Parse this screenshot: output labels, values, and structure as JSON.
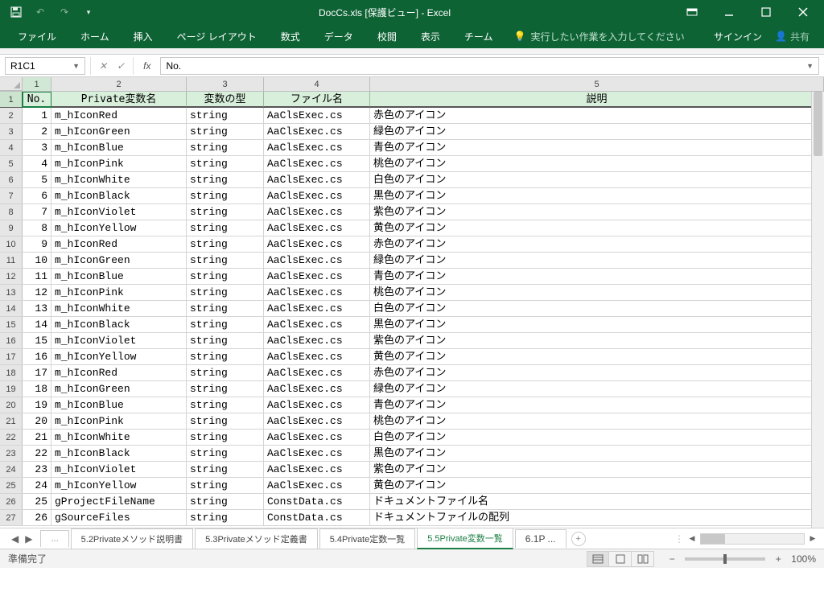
{
  "title": "DocCs.xls [保護ビュー] - Excel",
  "ribbon": {
    "file": "ファイル",
    "home": "ホーム",
    "insert": "挿入",
    "pagelayout": "ページ レイアウト",
    "formulas": "数式",
    "data": "データ",
    "review": "校閲",
    "view": "表示",
    "team": "チーム",
    "tellme": "実行したい作業を入力してください",
    "signin": "サインイン",
    "share": "共有"
  },
  "namebox": "R1C1",
  "formula": "No.",
  "colnums": {
    "c1": "1",
    "c2": "2",
    "c3": "3",
    "c4": "4",
    "c5": "5"
  },
  "headers": {
    "no": "No.",
    "name": "Private変数名",
    "type": "変数の型",
    "file": "ファイル名",
    "desc": "説明"
  },
  "rows": [
    {
      "n": "1",
      "name": "m_hIconRed",
      "type": "string",
      "file": "AaClsExec.cs",
      "desc": "赤色のアイコン"
    },
    {
      "n": "2",
      "name": "m_hIconGreen",
      "type": "string",
      "file": "AaClsExec.cs",
      "desc": "緑色のアイコン"
    },
    {
      "n": "3",
      "name": "m_hIconBlue",
      "type": "string",
      "file": "AaClsExec.cs",
      "desc": "青色のアイコン"
    },
    {
      "n": "4",
      "name": "m_hIconPink",
      "type": "string",
      "file": "AaClsExec.cs",
      "desc": "桃色のアイコン"
    },
    {
      "n": "5",
      "name": "m_hIconWhite",
      "type": "string",
      "file": "AaClsExec.cs",
      "desc": "白色のアイコン"
    },
    {
      "n": "6",
      "name": "m_hIconBlack",
      "type": "string",
      "file": "AaClsExec.cs",
      "desc": "黒色のアイコン"
    },
    {
      "n": "7",
      "name": "m_hIconViolet",
      "type": "string",
      "file": "AaClsExec.cs",
      "desc": "紫色のアイコン"
    },
    {
      "n": "8",
      "name": "m_hIconYellow",
      "type": "string",
      "file": "AaClsExec.cs",
      "desc": "黄色のアイコン"
    },
    {
      "n": "9",
      "name": "m_hIconRed",
      "type": "string",
      "file": "AaClsExec.cs",
      "desc": "赤色のアイコン"
    },
    {
      "n": "10",
      "name": "m_hIconGreen",
      "type": "string",
      "file": "AaClsExec.cs",
      "desc": "緑色のアイコン"
    },
    {
      "n": "11",
      "name": "m_hIconBlue",
      "type": "string",
      "file": "AaClsExec.cs",
      "desc": "青色のアイコン"
    },
    {
      "n": "12",
      "name": "m_hIconPink",
      "type": "string",
      "file": "AaClsExec.cs",
      "desc": "桃色のアイコン"
    },
    {
      "n": "13",
      "name": "m_hIconWhite",
      "type": "string",
      "file": "AaClsExec.cs",
      "desc": "白色のアイコン"
    },
    {
      "n": "14",
      "name": "m_hIconBlack",
      "type": "string",
      "file": "AaClsExec.cs",
      "desc": "黒色のアイコン"
    },
    {
      "n": "15",
      "name": "m_hIconViolet",
      "type": "string",
      "file": "AaClsExec.cs",
      "desc": "紫色のアイコン"
    },
    {
      "n": "16",
      "name": "m_hIconYellow",
      "type": "string",
      "file": "AaClsExec.cs",
      "desc": "黄色のアイコン"
    },
    {
      "n": "17",
      "name": "m_hIconRed",
      "type": "string",
      "file": "AaClsExec.cs",
      "desc": "赤色のアイコン"
    },
    {
      "n": "18",
      "name": "m_hIconGreen",
      "type": "string",
      "file": "AaClsExec.cs",
      "desc": "緑色のアイコン"
    },
    {
      "n": "19",
      "name": "m_hIconBlue",
      "type": "string",
      "file": "AaClsExec.cs",
      "desc": "青色のアイコン"
    },
    {
      "n": "20",
      "name": "m_hIconPink",
      "type": "string",
      "file": "AaClsExec.cs",
      "desc": "桃色のアイコン"
    },
    {
      "n": "21",
      "name": "m_hIconWhite",
      "type": "string",
      "file": "AaClsExec.cs",
      "desc": "白色のアイコン"
    },
    {
      "n": "22",
      "name": "m_hIconBlack",
      "type": "string",
      "file": "AaClsExec.cs",
      "desc": "黒色のアイコン"
    },
    {
      "n": "23",
      "name": "m_hIconViolet",
      "type": "string",
      "file": "AaClsExec.cs",
      "desc": "紫色のアイコン"
    },
    {
      "n": "24",
      "name": "m_hIconYellow",
      "type": "string",
      "file": "AaClsExec.cs",
      "desc": "黄色のアイコン"
    },
    {
      "n": "25",
      "name": "gProjectFileName",
      "type": "string",
      "file": "ConstData.cs",
      "desc": "ドキュメントファイル名"
    },
    {
      "n": "26",
      "name": "gSourceFiles",
      "type": "string",
      "file": "ConstData.cs",
      "desc": "ドキュメントファイルの配列"
    }
  ],
  "tabs": {
    "more": "...",
    "t1": "5.2Privateメソッド説明書",
    "t2": "5.3Privateメソッド定義書",
    "t3": "5.4Private定数一覧",
    "t4": "5.5Private変数一覧",
    "t5": "6.1P",
    "t5more": "..."
  },
  "status": {
    "ready": "準備完了",
    "zoom": "100%"
  }
}
